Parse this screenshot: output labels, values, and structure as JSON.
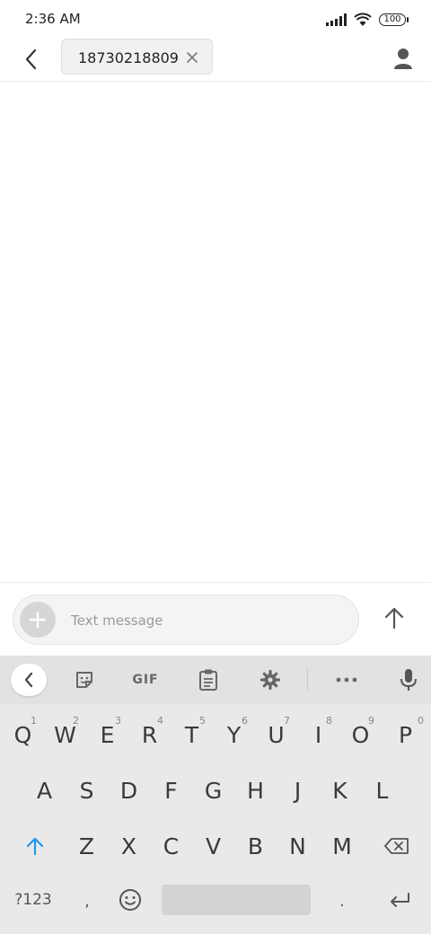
{
  "status_bar": {
    "time": "2:36 AM",
    "battery": "100",
    "icons": [
      "signal-icon",
      "wifi-icon",
      "battery-icon"
    ]
  },
  "header": {
    "back_icon": "back-arrow-icon",
    "recipient": "18730218809",
    "chip_close_icon": "close-icon",
    "contact_icon": "person-icon"
  },
  "composer": {
    "attach_icon": "plus-icon",
    "placeholder": "Text message",
    "value": "",
    "send_icon": "up-arrow-icon"
  },
  "keyboard": {
    "toolbar": {
      "collapse_icon": "chevron-left-icon",
      "sticker_icon": "sticker-icon",
      "gif_label": "GIF",
      "clipboard_icon": "clipboard-icon",
      "settings_icon": "gear-icon",
      "more_icon": "more-icon",
      "mic_icon": "mic-icon"
    },
    "row1": [
      {
        "key": "Q",
        "hint": "1"
      },
      {
        "key": "W",
        "hint": "2"
      },
      {
        "key": "E",
        "hint": "3"
      },
      {
        "key": "R",
        "hint": "4"
      },
      {
        "key": "T",
        "hint": "5"
      },
      {
        "key": "Y",
        "hint": "6"
      },
      {
        "key": "U",
        "hint": "7"
      },
      {
        "key": "I",
        "hint": "8"
      },
      {
        "key": "O",
        "hint": "9"
      },
      {
        "key": "P",
        "hint": "0"
      }
    ],
    "row2": [
      "A",
      "S",
      "D",
      "F",
      "G",
      "H",
      "J",
      "K",
      "L"
    ],
    "row3": [
      "Z",
      "X",
      "C",
      "V",
      "B",
      "N",
      "M"
    ],
    "shift_icon": "shift-arrow-icon",
    "backspace_icon": "backspace-icon",
    "symbols_label": "?123",
    "comma_label": ",",
    "emoji_icon": "emoji-icon",
    "period_label": ".",
    "enter_icon": "enter-icon"
  },
  "colors": {
    "accent": "#2196f3",
    "keyboard_bg": "#e9e9e9",
    "toolbar_bg": "#e2e2e2"
  }
}
